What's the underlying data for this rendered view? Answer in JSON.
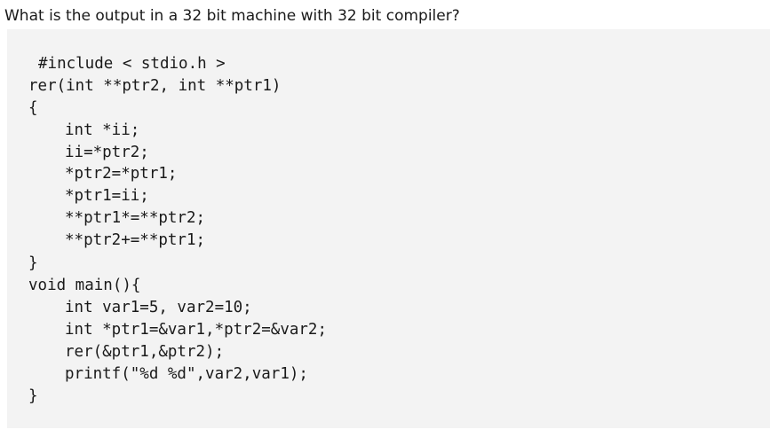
{
  "question": "What is the output in a 32 bit machine with 32 bit compiler?",
  "code": {
    "lines": [
      "#include < stdio.h >",
      "rer(int **ptr2, int **ptr1)",
      "{",
      "int *ii;",
      "ii=*ptr2;",
      "*ptr2=*ptr1;",
      "*ptr1=ii;",
      "**ptr1*=**ptr2;",
      "**ptr2+=**ptr1;",
      "}",
      "void main(){",
      "int var1=5, var2=10;",
      "int *ptr1=&var1,*ptr2=&var2;",
      "rer(&ptr1,&ptr2);",
      "printf(\"%d %d\",var2,var1);",
      "}"
    ]
  }
}
